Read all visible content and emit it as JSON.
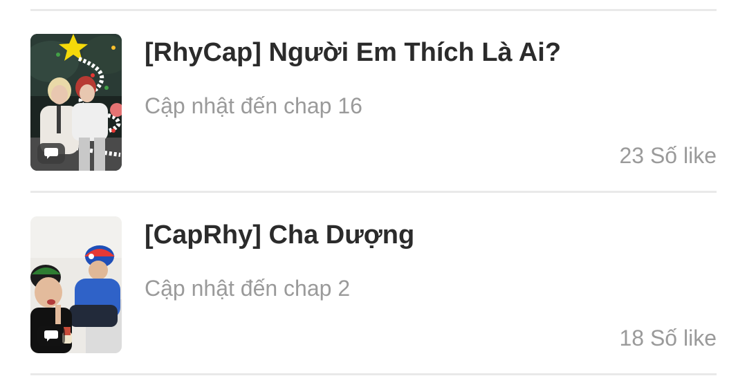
{
  "stories": [
    {
      "title": "[RhyCap] Người Em Thích Là Ai?",
      "update": "Cập nhật đến chap 16",
      "likes": "23 Số like",
      "cover_icon": "comment-bubble-icon"
    },
    {
      "title": "[CapRhy] Cha Dượng",
      "update": "Cập nhật đến chap 2",
      "likes": "18 Số like",
      "cover_icon": "comment-bubble-icon"
    }
  ],
  "colors": {
    "title": "#2b2b2b",
    "meta": "#9a9a9a",
    "divider": "#e9e9e9",
    "background": "#ffffff"
  }
}
